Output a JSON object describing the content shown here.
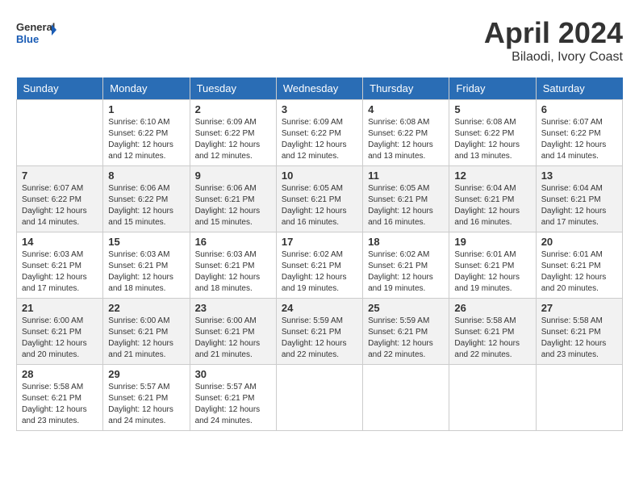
{
  "header": {
    "logo_line1": "General",
    "logo_line2": "Blue",
    "month_year": "April 2024",
    "location": "Bilaodi, Ivory Coast"
  },
  "weekdays": [
    "Sunday",
    "Monday",
    "Tuesday",
    "Wednesday",
    "Thursday",
    "Friday",
    "Saturday"
  ],
  "weeks": [
    [
      {
        "day": "",
        "info": ""
      },
      {
        "day": "1",
        "info": "Sunrise: 6:10 AM\nSunset: 6:22 PM\nDaylight: 12 hours\nand 12 minutes."
      },
      {
        "day": "2",
        "info": "Sunrise: 6:09 AM\nSunset: 6:22 PM\nDaylight: 12 hours\nand 12 minutes."
      },
      {
        "day": "3",
        "info": "Sunrise: 6:09 AM\nSunset: 6:22 PM\nDaylight: 12 hours\nand 12 minutes."
      },
      {
        "day": "4",
        "info": "Sunrise: 6:08 AM\nSunset: 6:22 PM\nDaylight: 12 hours\nand 13 minutes."
      },
      {
        "day": "5",
        "info": "Sunrise: 6:08 AM\nSunset: 6:22 PM\nDaylight: 12 hours\nand 13 minutes."
      },
      {
        "day": "6",
        "info": "Sunrise: 6:07 AM\nSunset: 6:22 PM\nDaylight: 12 hours\nand 14 minutes."
      }
    ],
    [
      {
        "day": "7",
        "info": "Sunrise: 6:07 AM\nSunset: 6:22 PM\nDaylight: 12 hours\nand 14 minutes."
      },
      {
        "day": "8",
        "info": "Sunrise: 6:06 AM\nSunset: 6:22 PM\nDaylight: 12 hours\nand 15 minutes."
      },
      {
        "day": "9",
        "info": "Sunrise: 6:06 AM\nSunset: 6:21 PM\nDaylight: 12 hours\nand 15 minutes."
      },
      {
        "day": "10",
        "info": "Sunrise: 6:05 AM\nSunset: 6:21 PM\nDaylight: 12 hours\nand 16 minutes."
      },
      {
        "day": "11",
        "info": "Sunrise: 6:05 AM\nSunset: 6:21 PM\nDaylight: 12 hours\nand 16 minutes."
      },
      {
        "day": "12",
        "info": "Sunrise: 6:04 AM\nSunset: 6:21 PM\nDaylight: 12 hours\nand 16 minutes."
      },
      {
        "day": "13",
        "info": "Sunrise: 6:04 AM\nSunset: 6:21 PM\nDaylight: 12 hours\nand 17 minutes."
      }
    ],
    [
      {
        "day": "14",
        "info": "Sunrise: 6:03 AM\nSunset: 6:21 PM\nDaylight: 12 hours\nand 17 minutes."
      },
      {
        "day": "15",
        "info": "Sunrise: 6:03 AM\nSunset: 6:21 PM\nDaylight: 12 hours\nand 18 minutes."
      },
      {
        "day": "16",
        "info": "Sunrise: 6:03 AM\nSunset: 6:21 PM\nDaylight: 12 hours\nand 18 minutes."
      },
      {
        "day": "17",
        "info": "Sunrise: 6:02 AM\nSunset: 6:21 PM\nDaylight: 12 hours\nand 19 minutes."
      },
      {
        "day": "18",
        "info": "Sunrise: 6:02 AM\nSunset: 6:21 PM\nDaylight: 12 hours\nand 19 minutes."
      },
      {
        "day": "19",
        "info": "Sunrise: 6:01 AM\nSunset: 6:21 PM\nDaylight: 12 hours\nand 19 minutes."
      },
      {
        "day": "20",
        "info": "Sunrise: 6:01 AM\nSunset: 6:21 PM\nDaylight: 12 hours\nand 20 minutes."
      }
    ],
    [
      {
        "day": "21",
        "info": "Sunrise: 6:00 AM\nSunset: 6:21 PM\nDaylight: 12 hours\nand 20 minutes."
      },
      {
        "day": "22",
        "info": "Sunrise: 6:00 AM\nSunset: 6:21 PM\nDaylight: 12 hours\nand 21 minutes."
      },
      {
        "day": "23",
        "info": "Sunrise: 6:00 AM\nSunset: 6:21 PM\nDaylight: 12 hours\nand 21 minutes."
      },
      {
        "day": "24",
        "info": "Sunrise: 5:59 AM\nSunset: 6:21 PM\nDaylight: 12 hours\nand 22 minutes."
      },
      {
        "day": "25",
        "info": "Sunrise: 5:59 AM\nSunset: 6:21 PM\nDaylight: 12 hours\nand 22 minutes."
      },
      {
        "day": "26",
        "info": "Sunrise: 5:58 AM\nSunset: 6:21 PM\nDaylight: 12 hours\nand 22 minutes."
      },
      {
        "day": "27",
        "info": "Sunrise: 5:58 AM\nSunset: 6:21 PM\nDaylight: 12 hours\nand 23 minutes."
      }
    ],
    [
      {
        "day": "28",
        "info": "Sunrise: 5:58 AM\nSunset: 6:21 PM\nDaylight: 12 hours\nand 23 minutes."
      },
      {
        "day": "29",
        "info": "Sunrise: 5:57 AM\nSunset: 6:21 PM\nDaylight: 12 hours\nand 24 minutes."
      },
      {
        "day": "30",
        "info": "Sunrise: 5:57 AM\nSunset: 6:21 PM\nDaylight: 12 hours\nand 24 minutes."
      },
      {
        "day": "",
        "info": ""
      },
      {
        "day": "",
        "info": ""
      },
      {
        "day": "",
        "info": ""
      },
      {
        "day": "",
        "info": ""
      }
    ]
  ]
}
